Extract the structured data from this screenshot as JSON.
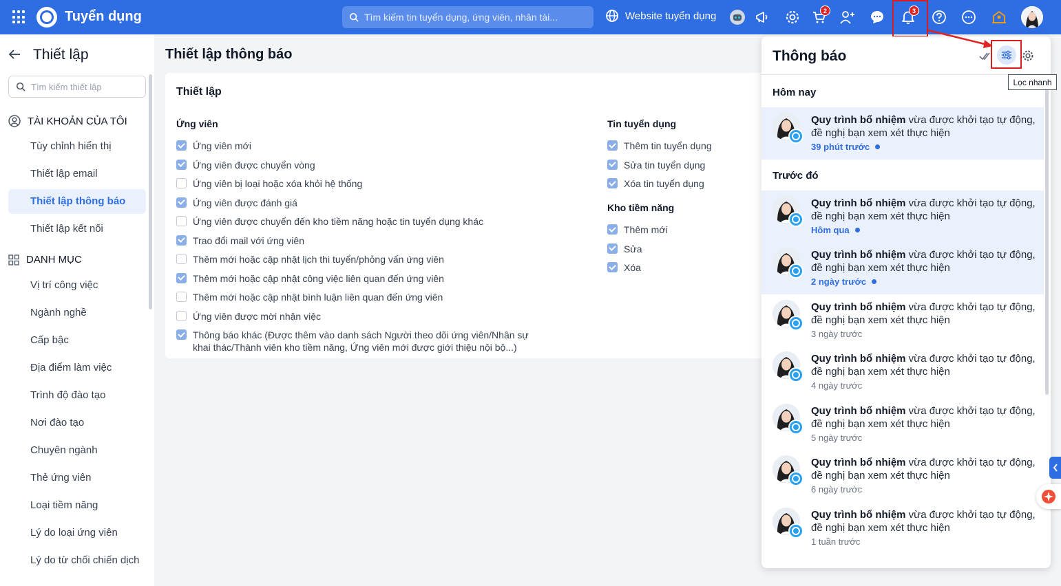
{
  "topbar": {
    "app_title": "Tuyển dụng",
    "search_placeholder": "Tìm kiếm tin tuyển dụng, ứng viên, nhân tài...",
    "website_label": "Website tuyển dụng",
    "cart_badge": "2",
    "bell_badge": "3"
  },
  "sidebar": {
    "title": "Thiết lập",
    "search_placeholder": "Tìm kiếm thiết lập",
    "section_account": "TÀI KHOẢN CỦA TÔI",
    "account_items": [
      "Tùy chỉnh hiển thị",
      "Thiết lập email",
      "Thiết lập thông báo",
      "Thiết lập kết nối"
    ],
    "section_category": "DANH MỤC",
    "category_items": [
      "Vị trí công việc",
      "Ngành nghề",
      "Cấp bậc",
      "Địa điểm làm việc",
      "Trình độ đào tạo",
      "Nơi đào tạo",
      "Chuyên ngành",
      "Thẻ ứng viên",
      "Loại tiềm năng",
      "Lý do loại ứng viên",
      "Lý do từ chối chiến dịch"
    ]
  },
  "main": {
    "page_title": "Thiết lập thông báo",
    "card_title": "Thiết lập",
    "col_candidate": {
      "title": "Ứng viên",
      "items": [
        {
          "label": "Ứng viên mới",
          "checked": true
        },
        {
          "label": "Ứng viên được chuyển vòng",
          "checked": true
        },
        {
          "label": "Ứng viên bị loại hoặc xóa khỏi hệ thống",
          "checked": false
        },
        {
          "label": "Ứng viên được đánh giá",
          "checked": true
        },
        {
          "label": "Ứng viên được chuyển đến kho tiềm năng hoặc tin tuyển dụng khác",
          "checked": false
        },
        {
          "label": "Trao đổi mail với ứng viên",
          "checked": true
        },
        {
          "label": "Thêm mới hoặc cập nhật lịch thi tuyển/phỏng vấn ứng viên",
          "checked": false
        },
        {
          "label": "Thêm mới hoặc cập nhật công việc liên quan đến ứng viên",
          "checked": true
        },
        {
          "label": "Thêm mới hoặc cập nhật bình luận liên quan đến ứng viên",
          "checked": false
        },
        {
          "label": "Ứng viên được mời nhận việc",
          "checked": false
        },
        {
          "label": "Thông báo khác (Được thêm vào danh sách Người theo dõi ứng viên/Nhân sự khai thác/Thành viên kho tiềm năng, Ứng viên mới được giới thiệu nội bộ...)",
          "checked": true
        }
      ]
    },
    "col_jobs": {
      "title": "Tin tuyển dụng",
      "items": [
        {
          "label": "Thêm tin tuyển dụng",
          "checked": true
        },
        {
          "label": "Sửa tin tuyển dụng",
          "checked": true
        },
        {
          "label": "Xóa tin tuyển dụng",
          "checked": true
        }
      ]
    },
    "col_pool": {
      "title": "Kho tiềm năng",
      "items": [
        {
          "label": "Thêm mới",
          "checked": true
        },
        {
          "label": "Sửa",
          "checked": true
        },
        {
          "label": "Xóa",
          "checked": true
        }
      ]
    }
  },
  "notifications": {
    "title": "Thông báo",
    "tooltip": "Lọc nhanh",
    "today_label": "Hôm nay",
    "earlier_label": "Trước đó",
    "bold_text": "Quy trình bổ nhiệm",
    "rest_text": " vừa được khởi tạo tự động, đề nghị bạn xem xét thực hiện",
    "items": [
      {
        "time": "39 phút trước",
        "unread": true
      },
      {
        "time": "Hôm qua",
        "unread": true
      },
      {
        "time": "2 ngày trước",
        "unread": true
      },
      {
        "time": "3 ngày trước",
        "unread": false
      },
      {
        "time": "4 ngày trước",
        "unread": false
      },
      {
        "time": "5 ngày trước",
        "unread": false
      },
      {
        "time": "6 ngày trước",
        "unread": false
      },
      {
        "time": "1 tuần trước",
        "unread": false
      }
    ]
  }
}
